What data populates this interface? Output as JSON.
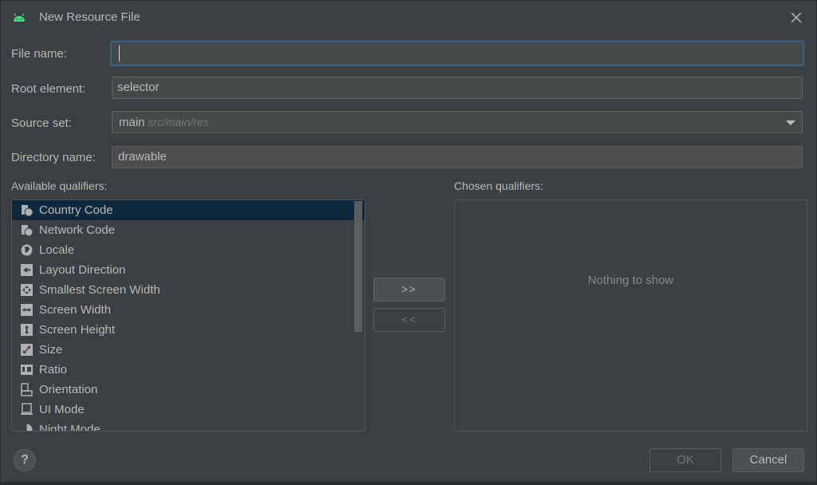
{
  "dialog": {
    "title": "New Resource File"
  },
  "form": {
    "file_name": {
      "label": "File name:",
      "value": ""
    },
    "root_element": {
      "label": "Root element:",
      "value": "selector"
    },
    "source_set": {
      "label": "Source set:",
      "value": "main",
      "hint": "src/main/res"
    },
    "directory_name": {
      "label": "Directory name:",
      "value": "drawable"
    }
  },
  "qualifiers": {
    "available_label": "Available qualifiers:",
    "chosen_label": "Chosen qualifiers:",
    "available": [
      {
        "label": "Country Code",
        "icon": "country-code-icon"
      },
      {
        "label": "Network Code",
        "icon": "network-code-icon"
      },
      {
        "label": "Locale",
        "icon": "globe-icon"
      },
      {
        "label": "Layout Direction",
        "icon": "layout-direction-icon"
      },
      {
        "label": "Smallest Screen Width",
        "icon": "smallest-width-icon"
      },
      {
        "label": "Screen Width",
        "icon": "screen-width-icon"
      },
      {
        "label": "Screen Height",
        "icon": "screen-height-icon"
      },
      {
        "label": "Size",
        "icon": "size-icon"
      },
      {
        "label": "Ratio",
        "icon": "ratio-icon"
      },
      {
        "label": "Orientation",
        "icon": "orientation-icon"
      },
      {
        "label": "UI Mode",
        "icon": "ui-mode-icon"
      },
      {
        "label": "Night Mode",
        "icon": "night-mode-icon"
      }
    ],
    "selected_index": 0,
    "add_label": ">>",
    "remove_label": "<<",
    "empty_text": "Nothing to show"
  },
  "footer": {
    "help_label": "?",
    "ok_label": "OK",
    "cancel_label": "Cancel"
  },
  "colors": {
    "background": "#3c3f41",
    "selection": "#0d293e",
    "focus_border": "#3d6185",
    "android_green": "#3ddc84"
  }
}
